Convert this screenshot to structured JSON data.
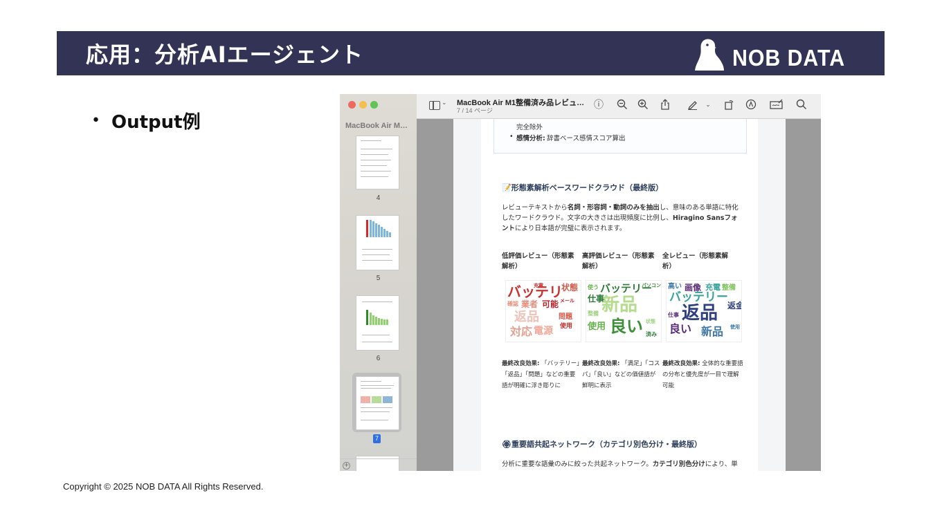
{
  "slide": {
    "title": "応用：分析AIエージェント",
    "logo_text": "NOB DATA",
    "bullet": "Output例",
    "copyright": "Copyright © 2025 NOB DATA All Rights Reserved."
  },
  "window": {
    "doc_title": "MacBook Air M1整備済み品レビュ…",
    "page_indicator": "7 / 14 ページ",
    "sidebar_title": "MacBook Air M…",
    "thumbnails": [
      {
        "label": "4"
      },
      {
        "label": "5"
      },
      {
        "label": "6"
      },
      {
        "label": "7",
        "selected": true
      }
    ]
  },
  "doc": {
    "box_line1": "完全除外",
    "box_line2_bold": "感情分析:",
    "box_line2_rest": " 辞書ベース感情スコア算出",
    "wordcloud_heading": "📝形態素解析ベースワードクラウド（最終版）",
    "para1_a": "レビューテキストから",
    "para1_bold": "名詞・形容詞・動詞のみを抽出",
    "para1_b": "し、意味のある単語に特化",
    "para2": "したワードクラウド。文字の大きさは出現頻度に比例し、",
    "para2_bold": "Hiragino Sansフォ",
    "para3_bold": "ント",
    "para3": "により日本語が完璧に表示されます。",
    "col1_header_1": "低評価レビュー（形態素",
    "col1_header_2": "解析）",
    "col2_header_1": "高評価レビュー（形態素",
    "col2_header_2": "解析）",
    "col3_header_1": "全レビュー（形態素解",
    "col3_header_2": "析）",
    "col1_caption_bold": "最終改良効果:",
    "col1_caption_1": " 「バッテリー」",
    "col1_caption_2": "「返品」「問題」などの重要",
    "col1_caption_3": "語が明確に浮き彫りに",
    "col2_caption_bold": "最終改良効果:",
    "col2_caption_1": " 「満足」「コス",
    "col2_caption_2": "パ」「良い」などの価値語が",
    "col2_caption_3": "鮮明に表示",
    "col3_caption_bold": "最終改良効果:",
    "col3_caption_1": " 全体的な重要語",
    "col3_caption_2": "の分布と優先度が一目で理解",
    "col3_caption_3": "可能",
    "network_heading": "🏵重要語共起ネットワーク（カテゴリ別色分け・最終版）",
    "para4_a": "分析に重要な語彙のみに絞った共起ネットワーク。",
    "para4_bold": "カテゴリ別色分け",
    "para4_b": "により、単"
  },
  "wordclouds": {
    "low": [
      "バッテリ",
      "状態",
      "業者",
      "可能",
      "返品",
      "対応",
      "電源",
      "問題",
      "使用",
      "確認",
      "メール",
      "充電"
    ],
    "high": [
      "新品",
      "良い",
      "バッテリー",
      "使用",
      "仕事",
      "使う",
      "パソコン",
      "済み",
      "状態",
      "整備"
    ],
    "all": [
      "返品",
      "バッテリー",
      "良い",
      "新品",
      "画像",
      "充電",
      "高い",
      "整備",
      "返金",
      "使用",
      "仕事"
    ]
  },
  "colors": {
    "header_bg": "#333355",
    "accent_blue": "#2f6fe0",
    "low_palette": [
      "#c9312f",
      "#e58f7e",
      "#d45b4a",
      "#b8232a",
      "#f0a99a"
    ],
    "high_palette": [
      "#66b24c",
      "#9cd27e",
      "#3f8f3a",
      "#b5dc8c",
      "#2a7a36"
    ],
    "all_palette": [
      "#2f3f7e",
      "#37a39a",
      "#5a2d7a",
      "#7fc45b",
      "#3d78a8"
    ]
  }
}
